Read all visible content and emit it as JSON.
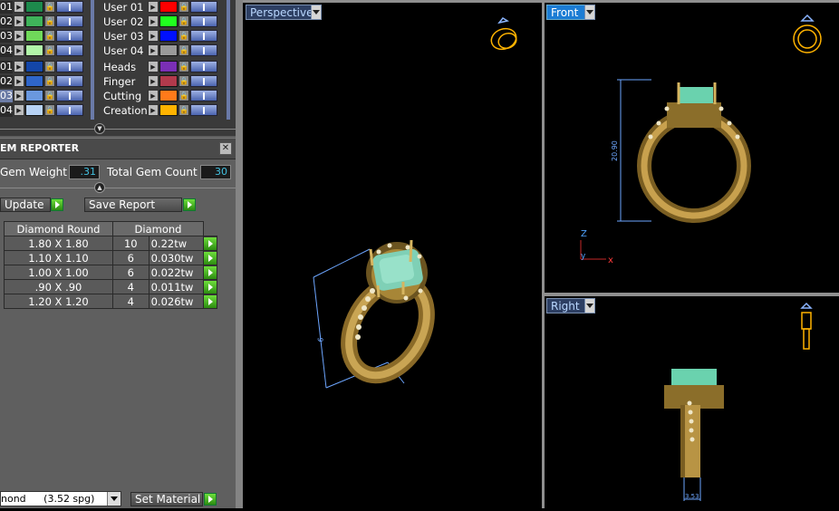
{
  "layers_left": [
    {
      "num": "01",
      "color": "#1d8a4c"
    },
    {
      "num": "02",
      "color": "#3fb35a"
    },
    {
      "num": "03",
      "color": "#70d95a"
    },
    {
      "num": "04",
      "color": "#b2f5a9"
    },
    {
      "num": "01",
      "color": "#1346a8"
    },
    {
      "num": "02",
      "color": "#2f66c9"
    },
    {
      "num": "03",
      "color": "#6a98de",
      "selected": true
    },
    {
      "num": "04",
      "color": "#b7d2f5"
    }
  ],
  "layers_right": [
    {
      "name": "User 01",
      "color": "#ff0000"
    },
    {
      "name": "User 02",
      "color": "#21ff1f"
    },
    {
      "name": "User 03",
      "color": "#0010ff"
    },
    {
      "name": "User 04",
      "color": "#9a9a9a"
    },
    {
      "name": "Heads",
      "color": "#7a2fb5"
    },
    {
      "name": "Finger",
      "color": "#b23a4c"
    },
    {
      "name": "Cutting",
      "color": "#ff7a1a"
    },
    {
      "name": "Creation",
      "color": "#ffb300"
    }
  ],
  "gem_reporter": {
    "title": "EM REPORTER",
    "gem_weight_label": "Gem Weight",
    "gem_weight_value": ".31",
    "total_gem_count_label": "Total Gem Count",
    "total_gem_count_value": "30",
    "update_label": "Update",
    "save_report_label": "Save Report",
    "table_headers": [
      "Diamond Round",
      "Diamond"
    ],
    "rows": [
      [
        "1.80 X 1.80",
        "10",
        "0.22tw"
      ],
      [
        "1.10 X 1.10",
        "6",
        "0.030tw"
      ],
      [
        "1.00 X 1.00",
        "6",
        "0.022tw"
      ],
      [
        ".90 X .90",
        "4",
        "0.011tw"
      ],
      [
        "1.20 X 1.20",
        "4",
        "0.026tw"
      ]
    ]
  },
  "material": {
    "name": "nond",
    "density": "(3.52 spg)",
    "set_label": "Set Material"
  },
  "viewports": {
    "perspective": "Perspective",
    "front": "Front",
    "right": "Right"
  },
  "dimensions": {
    "front": "20.90",
    "right": "3.53",
    "perspective": "6"
  },
  "axes": {
    "z": "Z",
    "x": "x",
    "y": "y"
  }
}
